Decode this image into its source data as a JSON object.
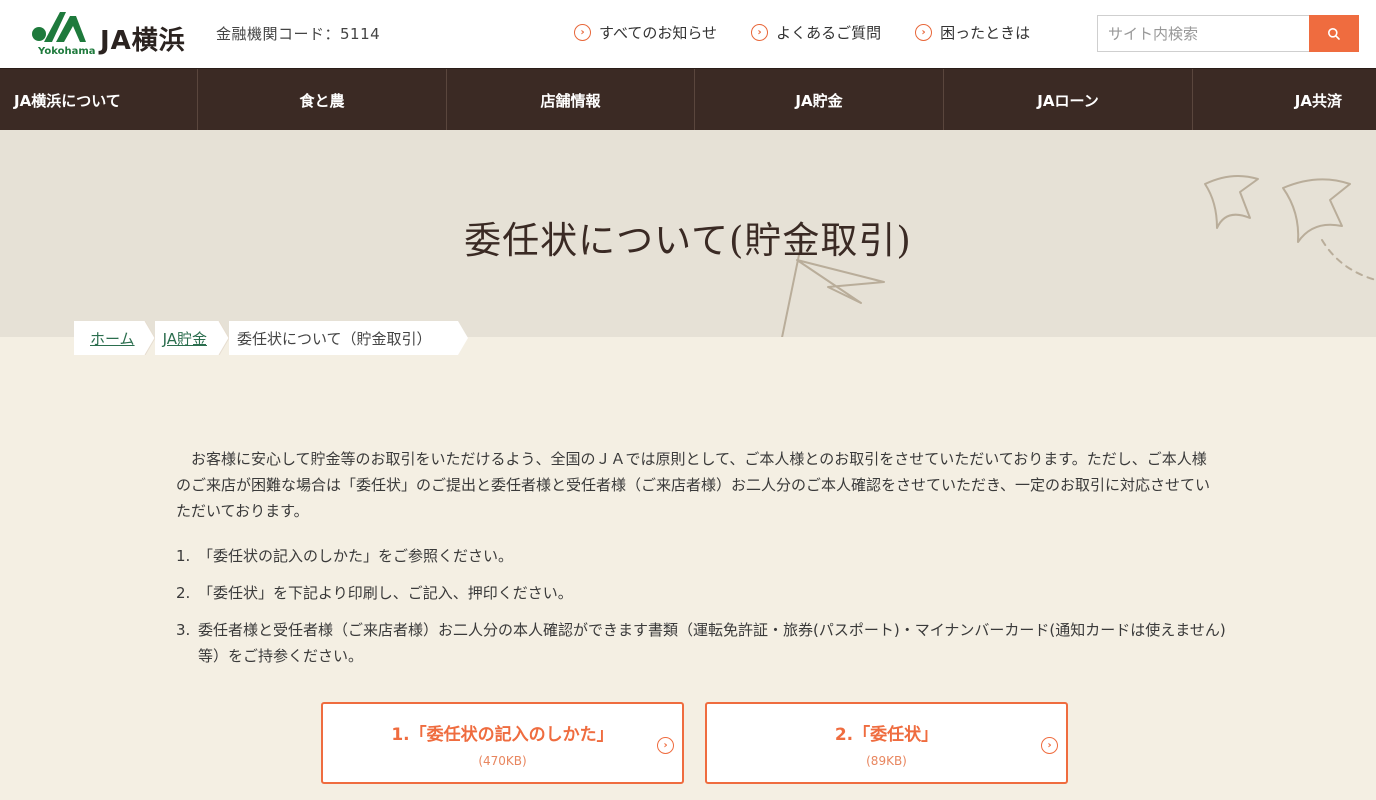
{
  "header": {
    "logo_text": "JA横浜",
    "logo_sub": "Yokohama",
    "bank_code": "金融機関コード：5114",
    "util_links": [
      {
        "label": "すべてのお知らせ",
        "icon": "chevron-circle-icon"
      },
      {
        "label": "よくあるご質問",
        "icon": "chevron-circle-icon"
      },
      {
        "label": "困ったときは",
        "icon": "chevron-circle-icon"
      }
    ],
    "search": {
      "placeholder": "サイト内検索",
      "button_icon": "search-icon"
    }
  },
  "nav": [
    {
      "label": "JA横浜について"
    },
    {
      "label": "食と農"
    },
    {
      "label": "店舗情報"
    },
    {
      "label": "JA貯金"
    },
    {
      "label": "JAローン"
    },
    {
      "label": "JA共済"
    }
  ],
  "hero": {
    "title": "委任状について(貯金取引)"
  },
  "breadcrumb": {
    "home": "ホーム",
    "parent": "JA貯金",
    "current": "委任状について（貯金取引）"
  },
  "intro": "　お客様に安心して貯金等のお取引をいただけるよう、全国のＪＡでは原則として、ご本人様とのお取引をさせていただいております。ただし、ご本人様のご来店が困難な場合は「委任状」のご提出と委任者様と受任者様（ご来店者様）お二人分のご本人確認をさせていただき、一定のお取引に対応させていただいております。",
  "steps": [
    {
      "num": "1.",
      "text": "「委任状の記入のしかた」をご参照ください。"
    },
    {
      "num": "2.",
      "text": "「委任状」を下記より印刷し、ご記入、押印ください。"
    },
    {
      "num": "3.",
      "text": "委任者様と受任者様（ご来店者様）お二人分の本人確認ができます書類（運転免許証・旅券(パスポート)・マイナンバーカード(通知カードは使えません)等）をご持参ください。"
    }
  ],
  "downloads": [
    {
      "title": "1.「委任状の記入のしかた」",
      "size": "(470KB)"
    },
    {
      "title": "2.「委任状」",
      "size": "(89KB)"
    }
  ],
  "colors": {
    "accent": "#ef6c3f",
    "nav_bg": "#3b2a24",
    "brand_green": "#1e7a3c",
    "link": "#2b6e4e"
  }
}
